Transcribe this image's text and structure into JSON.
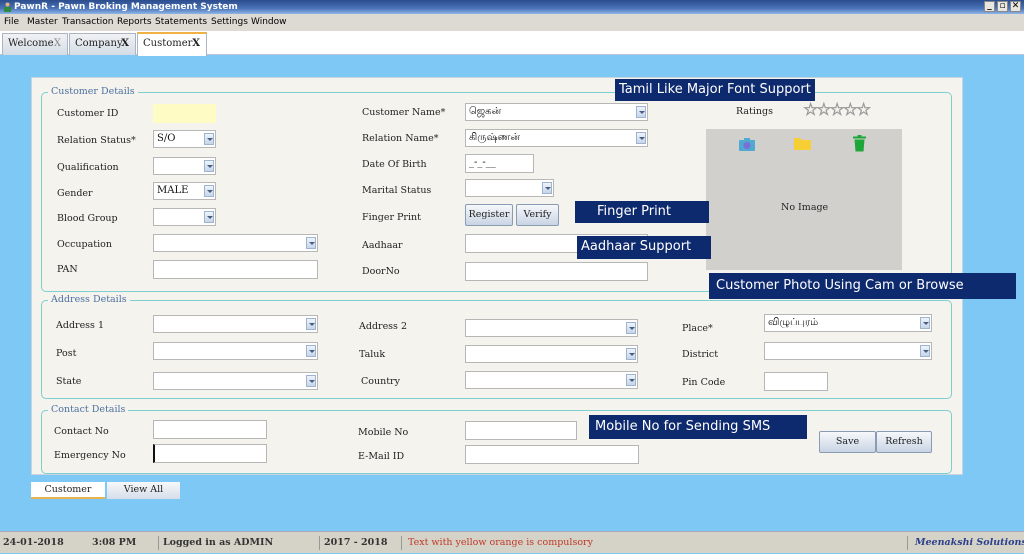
{
  "window": {
    "title": "PawnR - Pawn Broking Management System",
    "controls": {
      "minimize": "_",
      "restore": "▫",
      "close": "✕"
    }
  },
  "menu": [
    "File",
    "Master",
    "Transaction",
    "Reports",
    "Statements",
    "Settings",
    "Window"
  ],
  "tabs": [
    {
      "label": "Welcome",
      "close": "X",
      "active": false
    },
    {
      "label": "Company",
      "close": "X",
      "active": false
    },
    {
      "label": "Customer",
      "close": "X",
      "active": true
    }
  ],
  "customer_details": {
    "title": "Customer Details",
    "customer_id": {
      "label": "Customer ID",
      "value": ""
    },
    "relation_status": {
      "label": "Relation Status*",
      "value": "S/O"
    },
    "qualification": {
      "label": "Qualification",
      "value": ""
    },
    "gender": {
      "label": "Gender",
      "value": "MALE"
    },
    "blood_group": {
      "label": "Blood Group",
      "value": ""
    },
    "occupation": {
      "label": "Occupation",
      "value": ""
    },
    "pan": {
      "label": "PAN",
      "value": ""
    },
    "customer_name": {
      "label": "Customer Name*",
      "value": "ஜெகன்"
    },
    "relation_name": {
      "label": "Relation Name*",
      "value": "கிருஷ்ணன்"
    },
    "date_of_birth": {
      "label": "Date Of Birth",
      "value": "_-_-__"
    },
    "marital_status": {
      "label": "Marital Status",
      "value": ""
    },
    "finger_print": {
      "label": "Finger Print",
      "register": "Register",
      "verify": "Verify"
    },
    "aadhaar": {
      "label": "Aadhaar",
      "value": ""
    },
    "door_no": {
      "label": "DoorNo",
      "value": ""
    },
    "ratings": {
      "label": "Ratings",
      "stars": "☆☆☆☆☆",
      "value": 0,
      "max": 5
    },
    "photo": {
      "placeholder": "No Image",
      "icons": [
        "camera-icon",
        "folder-icon",
        "trash-icon"
      ]
    }
  },
  "address_details": {
    "title": "Address Details",
    "address1": {
      "label": "Address 1",
      "value": ""
    },
    "post": {
      "label": "Post",
      "value": ""
    },
    "state": {
      "label": "State",
      "value": ""
    },
    "address2": {
      "label": "Address 2",
      "value": ""
    },
    "taluk": {
      "label": "Taluk",
      "value": ""
    },
    "country": {
      "label": "Country",
      "value": ""
    },
    "place": {
      "label": "Place*",
      "value": "விழுப்புரம்"
    },
    "district": {
      "label": "District",
      "value": ""
    },
    "pin_code": {
      "label": "Pin Code",
      "value": ""
    }
  },
  "contact_details": {
    "title": "Contact Details",
    "contact_no": {
      "label": "Contact No",
      "value": ""
    },
    "emergency_no": {
      "label": "Emergency No",
      "value": ""
    },
    "mobile_no": {
      "label": "Mobile No",
      "value": ""
    },
    "email_id": {
      "label": "E-Mail ID",
      "value": ""
    },
    "save": "Save",
    "refresh": "Refresh"
  },
  "callouts": {
    "tamil": "Tamil Like Major Font Support",
    "finger": "Finger Print",
    "aadhaar": "Aadhaar Support",
    "photo": "Customer Photo Using Cam or Browse",
    "mobile": "Mobile No for Sending SMS"
  },
  "bottom_tabs": [
    "Customer",
    "View All"
  ],
  "status": {
    "date": "24-01-2018",
    "time": "3:08 PM",
    "login": "Logged in as  ADMIN",
    "fin_year": "2017  -  2018",
    "hint": "Text with yellow orange is compulsory",
    "company": "Meenakshi Solutions"
  },
  "colors": {
    "required_field": "#fffbc4",
    "hint_text": "#c0392b",
    "callout_bg": "#0e2a6e",
    "brand": "#2b3f8c"
  }
}
